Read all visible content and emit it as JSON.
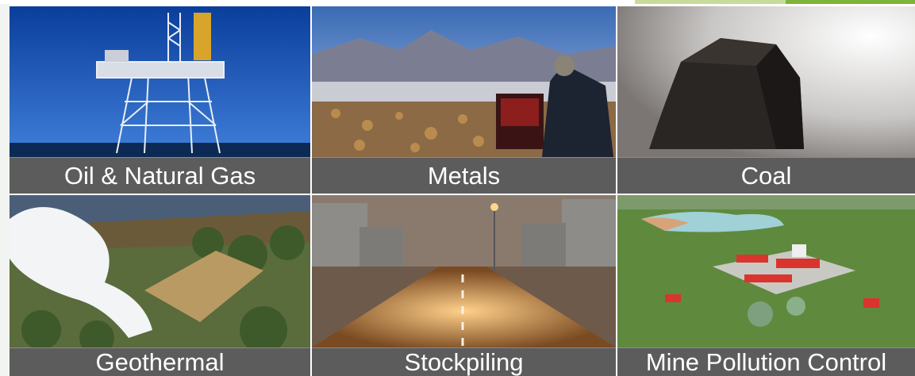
{
  "slide": {
    "tiles": [
      {
        "id": "oil-gas",
        "label": "Oil & Natural Gas",
        "image": "offshore-oil-platform"
      },
      {
        "id": "metals",
        "label": "Metals",
        "image": "geologist-surveying-mountains"
      },
      {
        "id": "coal",
        "label": "Coal",
        "image": "lump-of-coal"
      },
      {
        "id": "geothermal",
        "label": "Geothermal",
        "image": "geothermal-steam-plant"
      },
      {
        "id": "stockpiling",
        "label": "Stockpiling",
        "image": "oil-storage-tanks-road"
      },
      {
        "id": "mine-pollution",
        "label": "Mine Pollution Control",
        "image": "water-treatment-facility"
      }
    ]
  },
  "colors": {
    "caption_bg": "#5c5c5c",
    "caption_text": "#ffffff",
    "accent_light": "#c7dc9a",
    "accent_dark": "#7fb33a"
  }
}
